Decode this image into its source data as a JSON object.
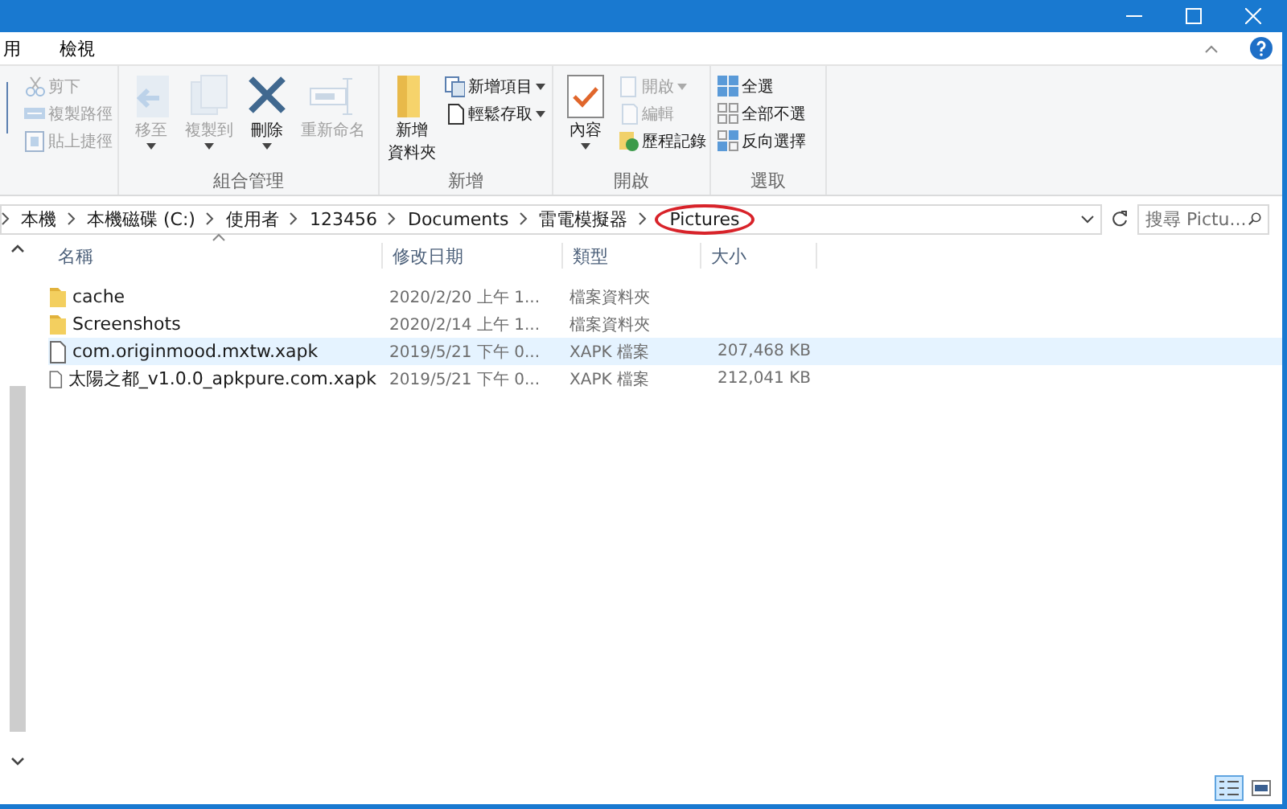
{
  "ribbon_tabs": [
    {
      "label": "用",
      "selected": false
    },
    {
      "label": "檢視",
      "selected": false
    }
  ],
  "ribbon_groups": [
    {
      "items": [
        {
          "label": "剪下",
          "kind": "small",
          "disabled": true,
          "dropdown": false
        },
        {
          "label": "複製路徑",
          "kind": "small",
          "disabled": true,
          "dropdown": false
        },
        {
          "label": "貼上捷徑",
          "kind": "small",
          "disabled": true,
          "dropdown": false
        }
      ]
    },
    {
      "title": "組合管理",
      "items": [
        {
          "label": "移至",
          "kind": "large",
          "disabled": true,
          "dropdown": true
        },
        {
          "label": "複製到",
          "kind": "large",
          "disabled": true,
          "dropdown": true
        },
        {
          "label": "刪除",
          "kind": "large",
          "disabled": false,
          "dropdown": true
        },
        {
          "label": "重新命名",
          "kind": "large",
          "disabled": true,
          "dropdown": false
        }
      ]
    },
    {
      "title": "新增",
      "items": [
        {
          "label": [
            "新增",
            "資料夾"
          ],
          "kind": "large",
          "disabled": false,
          "dropdown": false
        },
        {
          "label": "新增項目",
          "kind": "small",
          "disabled": false,
          "dropdown": true
        },
        {
          "label": "輕鬆存取",
          "kind": "small",
          "disabled": false,
          "dropdown": true
        }
      ]
    },
    {
      "title": "開啟",
      "items": [
        {
          "label": "內容",
          "kind": "large",
          "disabled": false,
          "dropdown": true
        },
        {
          "label": "開啟",
          "kind": "small",
          "disabled": true,
          "dropdown": true
        },
        {
          "label": "編輯",
          "kind": "small",
          "disabled": true,
          "dropdown": false
        },
        {
          "label": "歷程記錄",
          "kind": "small",
          "disabled": false,
          "dropdown": false
        }
      ]
    },
    {
      "title": "選取",
      "items": [
        {
          "label": "全選",
          "kind": "small",
          "disabled": false,
          "dropdown": false
        },
        {
          "label": "全部不選",
          "kind": "small",
          "disabled": false,
          "dropdown": false
        },
        {
          "label": "反向選擇",
          "kind": "small",
          "disabled": false,
          "dropdown": false
        }
      ]
    }
  ],
  "breadcrumb": [
    {
      "label": "本機",
      "circled": false
    },
    {
      "label": "本機磁碟 (C:)",
      "circled": false
    },
    {
      "label": "使用者",
      "circled": false
    },
    {
      "label": "123456",
      "circled": false
    },
    {
      "label": "Documents",
      "circled": false
    },
    {
      "label": "雷電模擬器",
      "circled": false
    },
    {
      "label": "Pictures",
      "circled": true
    }
  ],
  "search": {
    "placeholder": "搜尋 Pictu..."
  },
  "table": {
    "columns": [
      "名稱",
      "修改日期",
      "類型",
      "大小"
    ],
    "rows": [
      {
        "kind": "folder",
        "selected": false,
        "cells": [
          "cache",
          "2020/2/20 上午 1...",
          "檔案資料夾",
          ""
        ]
      },
      {
        "kind": "folder",
        "selected": false,
        "cells": [
          "Screenshots",
          "2020/2/14 上午 1...",
          "檔案資料夾",
          ""
        ]
      },
      {
        "kind": "file",
        "selected": true,
        "cells": [
          "com.originmood.mxtw.xapk",
          "2019/5/21 下午 0...",
          "XAPK 檔案",
          "207,468 KB"
        ]
      },
      {
        "kind": "file",
        "selected": false,
        "cells": [
          "太陽之都_v1.0.0_apkpure.com.xapk",
          "2019/5/21 下午 0...",
          "XAPK 檔案",
          "212,041 KB"
        ]
      }
    ]
  },
  "view_modes": [
    {
      "kind": "details",
      "selected": true
    },
    {
      "kind": "thumbnails",
      "selected": false
    }
  ]
}
